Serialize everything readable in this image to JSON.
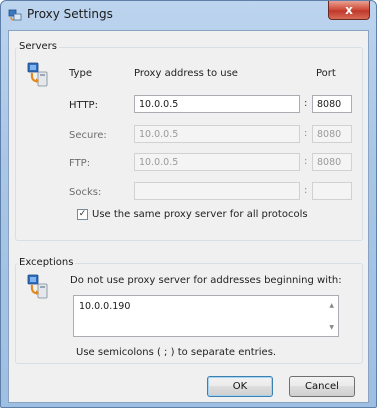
{
  "window": {
    "title": "Proxy Settings",
    "close_label": "x"
  },
  "servers": {
    "group_label": "Servers",
    "col_type": "Type",
    "col_address": "Proxy address to use",
    "col_port": "Port",
    "rows": [
      {
        "label": "HTTP:",
        "address": "10.0.0.5",
        "port": "8080",
        "enabled": true
      },
      {
        "label": "Secure:",
        "address": "10.0.0.5",
        "port": "8080",
        "enabled": false
      },
      {
        "label": "FTP:",
        "address": "10.0.0.5",
        "port": "8080",
        "enabled": false
      },
      {
        "label": "Socks:",
        "address": "",
        "port": "",
        "enabled": false
      }
    ],
    "colon": ":",
    "same_proxy_label": "Use the same proxy server for all protocols",
    "same_proxy_checked": true
  },
  "exceptions": {
    "group_label": "Exceptions",
    "description": "Do not use proxy server for addresses beginning with:",
    "value": "10.0.0.190",
    "hint": "Use semicolons ( ; ) to separate entries."
  },
  "buttons": {
    "ok": "OK",
    "cancel": "Cancel"
  },
  "colors": {
    "accent": "#3c7fb1",
    "close": "#c0392b"
  },
  "icons": {
    "title": "network-settings-icon",
    "servers": "network-computer-icon",
    "exceptions": "network-computer-icon"
  }
}
